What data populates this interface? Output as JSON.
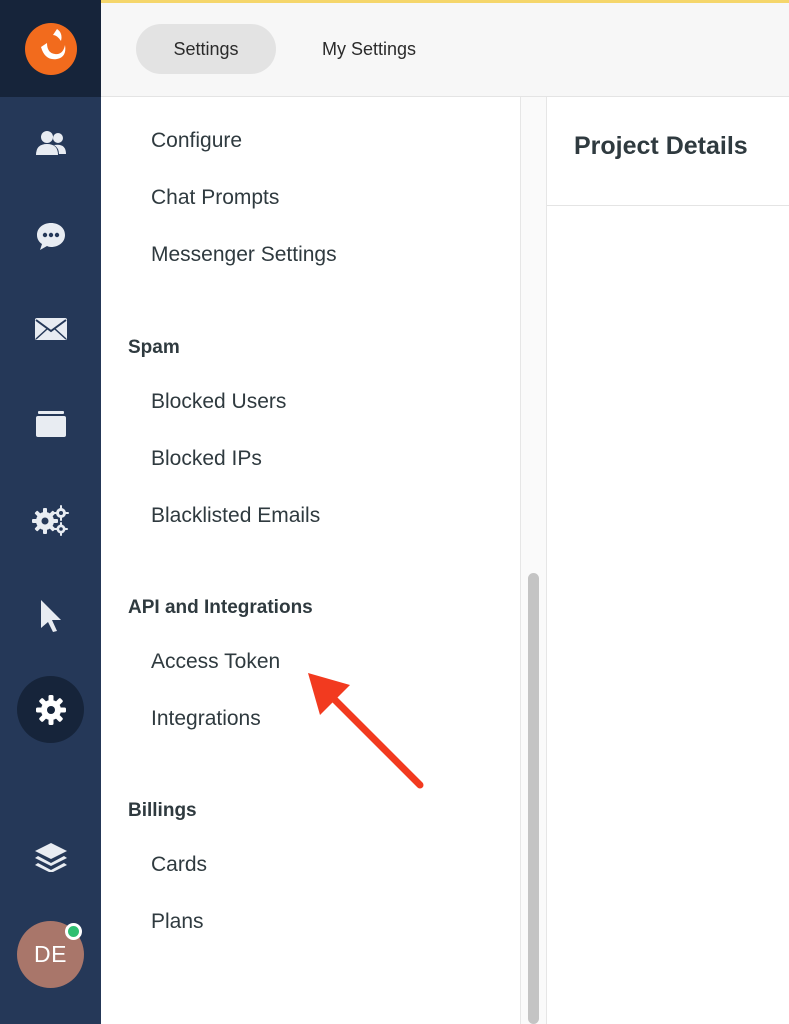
{
  "colors": {
    "rail_background": "#253858",
    "rail_dark": "#16243a",
    "accent_orange": "#f26b1d",
    "annotation_arrow": "#f23a1f",
    "presence_online": "#2fbf71",
    "avatar_background": "#a9766a"
  },
  "header": {
    "tabs": [
      {
        "label": "Settings",
        "active": true
      },
      {
        "label": "My Settings",
        "active": false
      }
    ]
  },
  "rail": {
    "logo": "brand-logo",
    "icons": [
      "users-icon",
      "chat-bubble-icon",
      "envelope-icon",
      "folder-icon",
      "gears-icon",
      "pointer-icon",
      "settings-gear-icon",
      "layers-icon"
    ],
    "active_icon": "settings-gear-icon",
    "avatar_initials": "DE",
    "avatar_status": "online"
  },
  "menu": {
    "items_top": [
      "Configure",
      "Chat Prompts",
      "Messenger Settings"
    ],
    "sections": [
      {
        "heading": "Spam",
        "items": [
          "Blocked Users",
          "Blocked IPs",
          "Blacklisted Emails"
        ]
      },
      {
        "heading": "API and Integrations",
        "items": [
          "Access Token",
          "Integrations"
        ]
      },
      {
        "heading": "Billings",
        "items": [
          "Cards",
          "Plans"
        ]
      }
    ]
  },
  "panel": {
    "title": "Project Details"
  },
  "annotation": {
    "target": "Access Token",
    "icon": "red-arrow"
  }
}
